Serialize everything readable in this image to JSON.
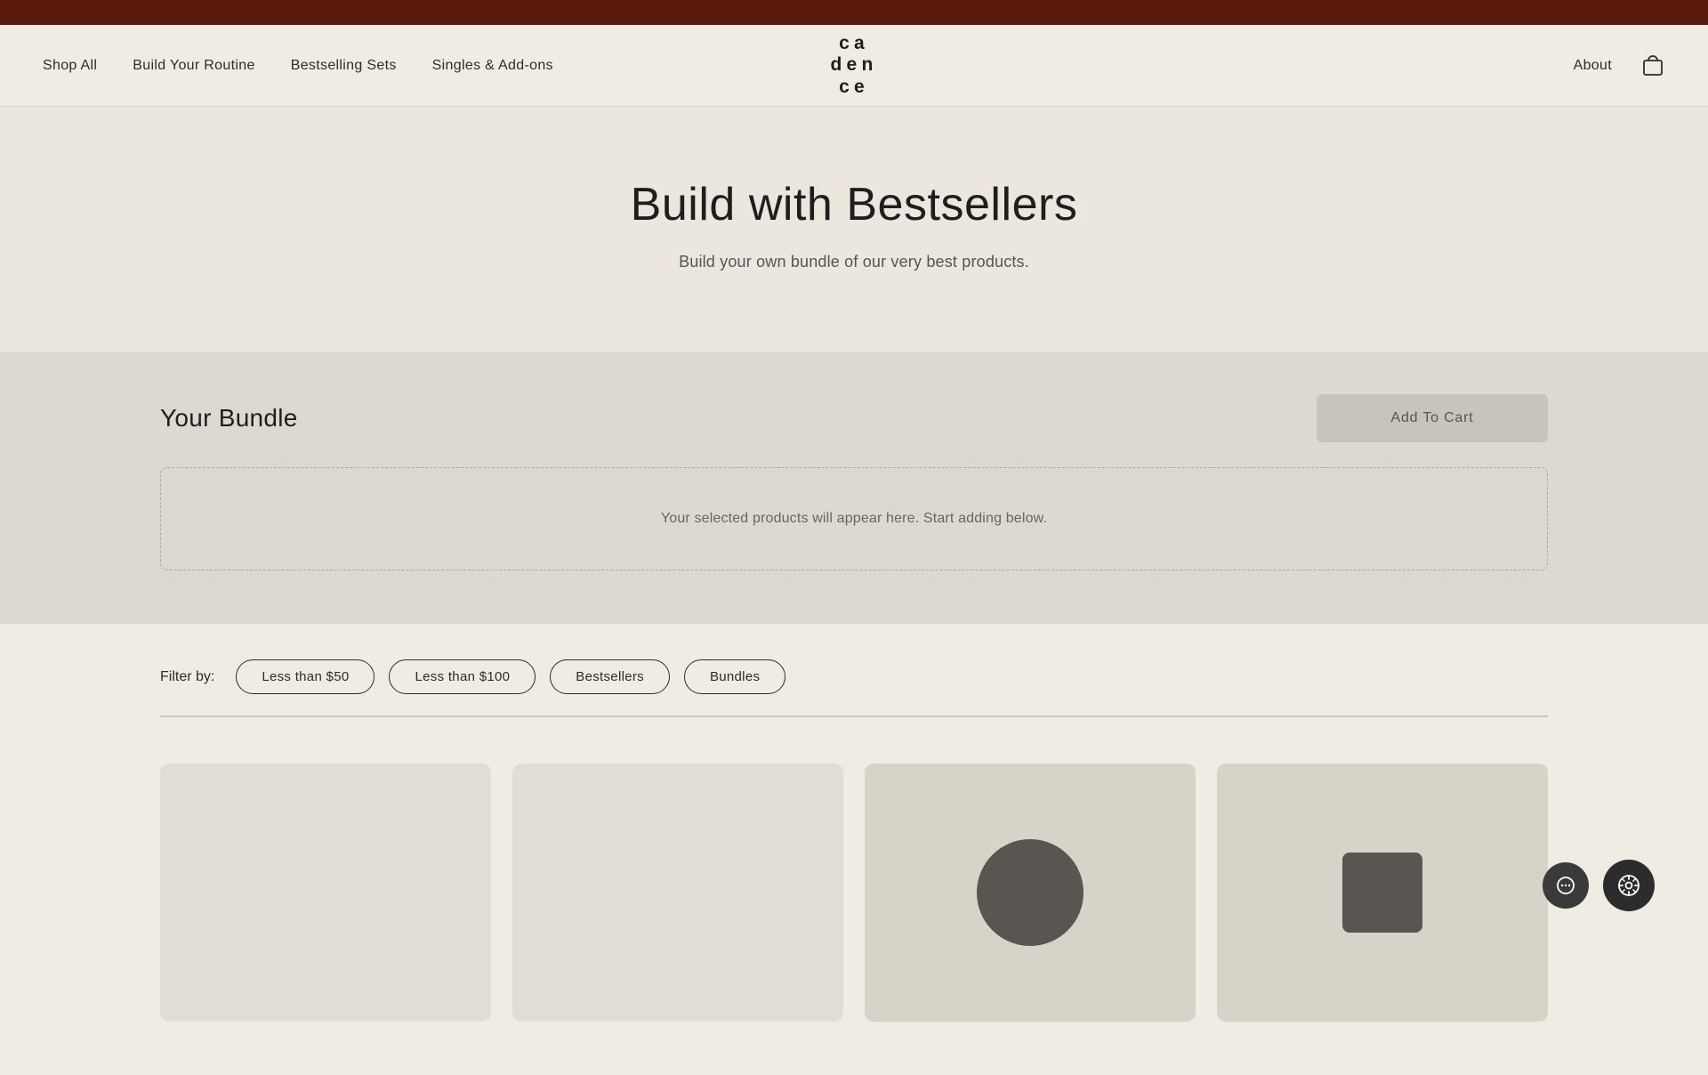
{
  "topBanner": {
    "bgColor": "#5c1a0f"
  },
  "navbar": {
    "navLinks": [
      {
        "label": "Shop All",
        "id": "shop-all"
      },
      {
        "label": "Build Your Routine",
        "id": "build-your-routine"
      },
      {
        "label": "Bestselling Sets",
        "id": "bestselling-sets"
      },
      {
        "label": "Singles & Add-ons",
        "id": "singles-add-ons"
      }
    ],
    "logo": {
      "line1": "ca",
      "line2": "den",
      "line3": "ce"
    },
    "rightLinks": [
      {
        "label": "About",
        "id": "about"
      }
    ],
    "cartIconLabel": "cart"
  },
  "hero": {
    "title": "Build with Bestsellers",
    "subtitle": "Build your own bundle of our very best products."
  },
  "bundle": {
    "sectionTitle": "Your Bundle",
    "addToCartLabel": "Add To Cart",
    "placeholderText": "Your selected products will appear here. Start adding below."
  },
  "filter": {
    "label": "Filter by:",
    "buttons": [
      {
        "label": "Less than $50",
        "id": "less-than-50"
      },
      {
        "label": "Less than $100",
        "id": "less-than-100"
      },
      {
        "label": "Bestsellers",
        "id": "bestsellers"
      },
      {
        "label": "Bundles",
        "id": "bundles"
      }
    ]
  },
  "products": {
    "items": [
      {
        "id": "product-1",
        "hasShape": false
      },
      {
        "id": "product-2",
        "hasShape": false
      },
      {
        "id": "product-3",
        "hasShape": true
      },
      {
        "id": "product-4",
        "hasShape": true
      }
    ]
  },
  "floatingButtons": {
    "chatIcon": "●",
    "settingsIcon": "⊕"
  }
}
